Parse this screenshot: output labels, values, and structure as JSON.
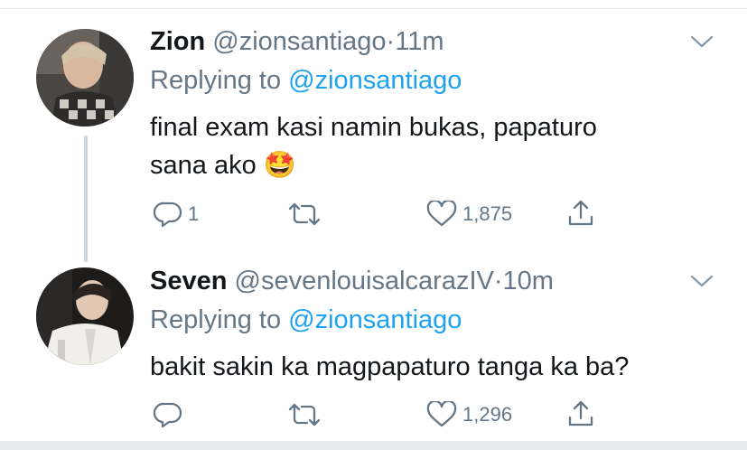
{
  "tweets": [
    {
      "name": "Zion",
      "handle": "@zionsantiago",
      "time": "11m",
      "replying_prefix": "Replying to",
      "replying_handle": "@zionsantiago",
      "text_line1": "final exam kasi namin bukas, papaturo",
      "text_line2": "sana ako",
      "emoji": "🤩",
      "reply_count": "1",
      "like_count": "1,875"
    },
    {
      "name": "Seven",
      "handle": "@sevenlouisalcarazIV",
      "time": "10m",
      "replying_prefix": "Replying to",
      "replying_handle": "@zionsantiago",
      "text_line1": "bakit sakin ka magpapaturo tanga ka ba?",
      "like_count": "1,296"
    }
  ],
  "colors": {
    "link": "#1da1f2",
    "secondary": "#657786",
    "border": "#e6ecf0",
    "thread": "#ccd6dd"
  },
  "icons": [
    "reply-icon",
    "retweet-icon",
    "like-icon",
    "share-icon",
    "chevron-down-icon"
  ]
}
